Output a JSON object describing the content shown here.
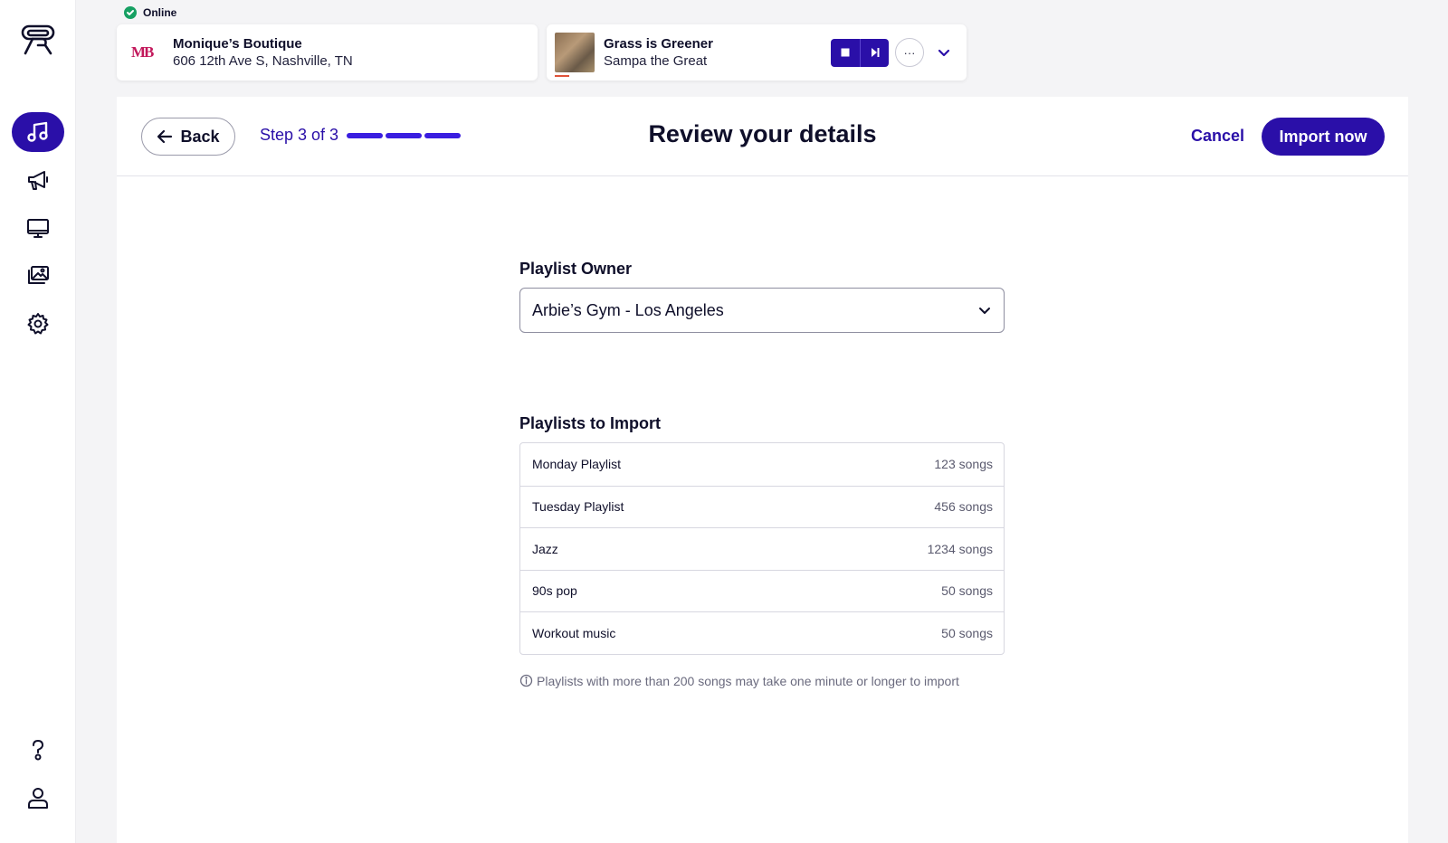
{
  "status": {
    "label": "Online",
    "color": "#16a063"
  },
  "location": {
    "logo_text": "MB",
    "name": "Monique’s Boutique",
    "address": "606 12th Ave S, Nashville, TN"
  },
  "player": {
    "track": "Grass is Greener",
    "artist": "Sampa the Great",
    "more_label": "···"
  },
  "sidebar": {
    "items": [
      {
        "name": "music",
        "active": true
      },
      {
        "name": "announcements",
        "active": false
      },
      {
        "name": "screens",
        "active": false
      },
      {
        "name": "media",
        "active": false
      },
      {
        "name": "settings",
        "active": false
      },
      {
        "name": "help",
        "active": false
      },
      {
        "name": "account",
        "active": false
      }
    ]
  },
  "header": {
    "back_label": "Back",
    "step_label": "Step 3 of 3",
    "steps_total": 3,
    "steps_done": 3,
    "title": "Review your details",
    "cancel_label": "Cancel",
    "import_label": "Import now"
  },
  "form": {
    "owner_label": "Playlist Owner",
    "owner_value": "Arbie’s Gym - Los Angeles",
    "playlists_label": "Playlists to Import",
    "playlists": [
      {
        "name": "Monday Playlist",
        "count": "123 songs"
      },
      {
        "name": "Tuesday Playlist",
        "count": "456 songs"
      },
      {
        "name": "Jazz",
        "count": "1234 songs"
      },
      {
        "name": "90s pop",
        "count": "50 songs"
      },
      {
        "name": "Workout music",
        "count": "50 songs"
      }
    ],
    "note": "Playlists with more than 200 songs may take one minute or longer to import"
  },
  "colors": {
    "accent": "#2a0fa8",
    "progress": "#3a1ee0"
  }
}
